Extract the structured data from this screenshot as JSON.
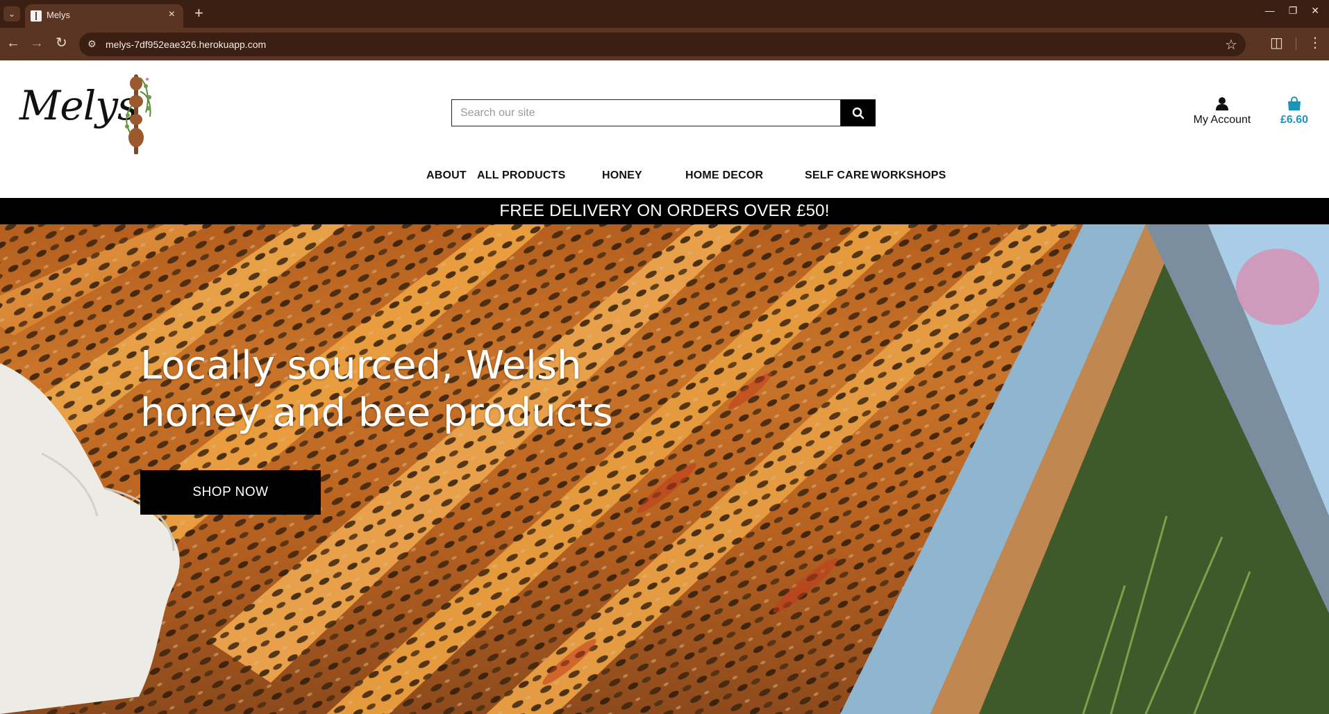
{
  "browser": {
    "tab_title": "Melys",
    "url": "melys-7df952eae326.herokuapp.com"
  },
  "header": {
    "logo_text": "Melys",
    "search": {
      "placeholder": "Search our site"
    },
    "account_label": "My Account",
    "bag_total": "£6.60"
  },
  "nav": {
    "items": [
      {
        "label": "ABOUT"
      },
      {
        "label": "ALL PRODUCTS"
      },
      {
        "label": "HONEY"
      },
      {
        "label": "HOME DECOR"
      },
      {
        "label": "SELF CARE"
      },
      {
        "label": "WORKSHOPS"
      }
    ]
  },
  "banner": {
    "text": "FREE DELIVERY ON ORDERS OVER £50!"
  },
  "hero": {
    "heading": "Locally sourced, Welsh honey and bee products",
    "cta_label": "SHOP NOW"
  },
  "colors": {
    "chrome_dark": "#3b1f12",
    "chrome_mid": "#5a3524",
    "accent_bag": "#1d93b7",
    "banner_bg": "#000000"
  },
  "icons": [
    "chevron-down-icon",
    "close-icon",
    "plus-icon",
    "minimize-icon",
    "restore-icon",
    "back-arrow-icon",
    "forward-arrow-icon",
    "reload-icon",
    "site-info-icon",
    "star-icon",
    "extensions-icon",
    "kebab-menu-icon",
    "search-icon",
    "user-icon",
    "shopping-bag-icon"
  ]
}
